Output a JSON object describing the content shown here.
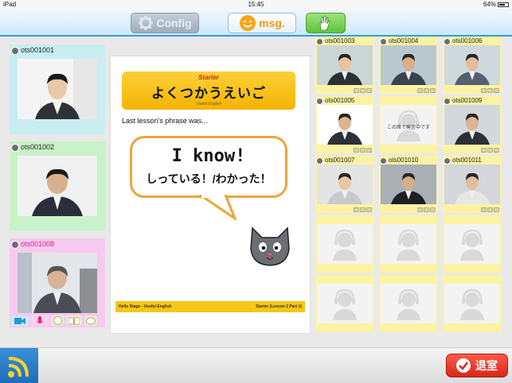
{
  "status_bar": {
    "device": "iPad",
    "time": "15:45",
    "battery": "64%"
  },
  "toolbar": {
    "config_label": "Config",
    "msg_label": "msg.",
    "hand_label": ""
  },
  "left_participants": [
    {
      "name": "ots001001"
    },
    {
      "name": "ots001002"
    },
    {
      "name": "ots001008"
    }
  ],
  "document": {
    "header_small": "Starter",
    "header_jp": "よくつかうえいご",
    "header_sub": "Useful English",
    "phrase_intro": "Last lesson's phrase was...",
    "bubble_en": "I know!",
    "bubble_jp": "しっている！/わかった！",
    "footer_left": "Hello Stage - Useful English",
    "footer_right": "Starter (Lesson 2 Part 1)"
  },
  "grid": [
    {
      "name": "ots001003",
      "video": true
    },
    {
      "name": "ots001004",
      "video": true
    },
    {
      "name": "ots001006",
      "video": true
    },
    {
      "name": "ots001005",
      "video": true
    },
    {
      "name": "",
      "video": false,
      "text": "この席で発言中です"
    },
    {
      "name": "ots001009",
      "video": true
    },
    {
      "name": "ots001007",
      "video": true
    },
    {
      "name": "ots001010",
      "video": true
    },
    {
      "name": "ots001011",
      "video": true
    },
    {
      "name": "",
      "video": false
    },
    {
      "name": "",
      "video": false
    },
    {
      "name": "",
      "video": false
    },
    {
      "name": "",
      "video": false
    },
    {
      "name": "",
      "video": false
    },
    {
      "name": "",
      "video": false
    }
  ],
  "bottom": {
    "exit_label": "退室"
  },
  "colors": {
    "accent": "#2e9fe0",
    "doc_yellow": "#f4b400",
    "exit_red": "#d8251b",
    "grid_yellow": "#fbf3a3"
  }
}
